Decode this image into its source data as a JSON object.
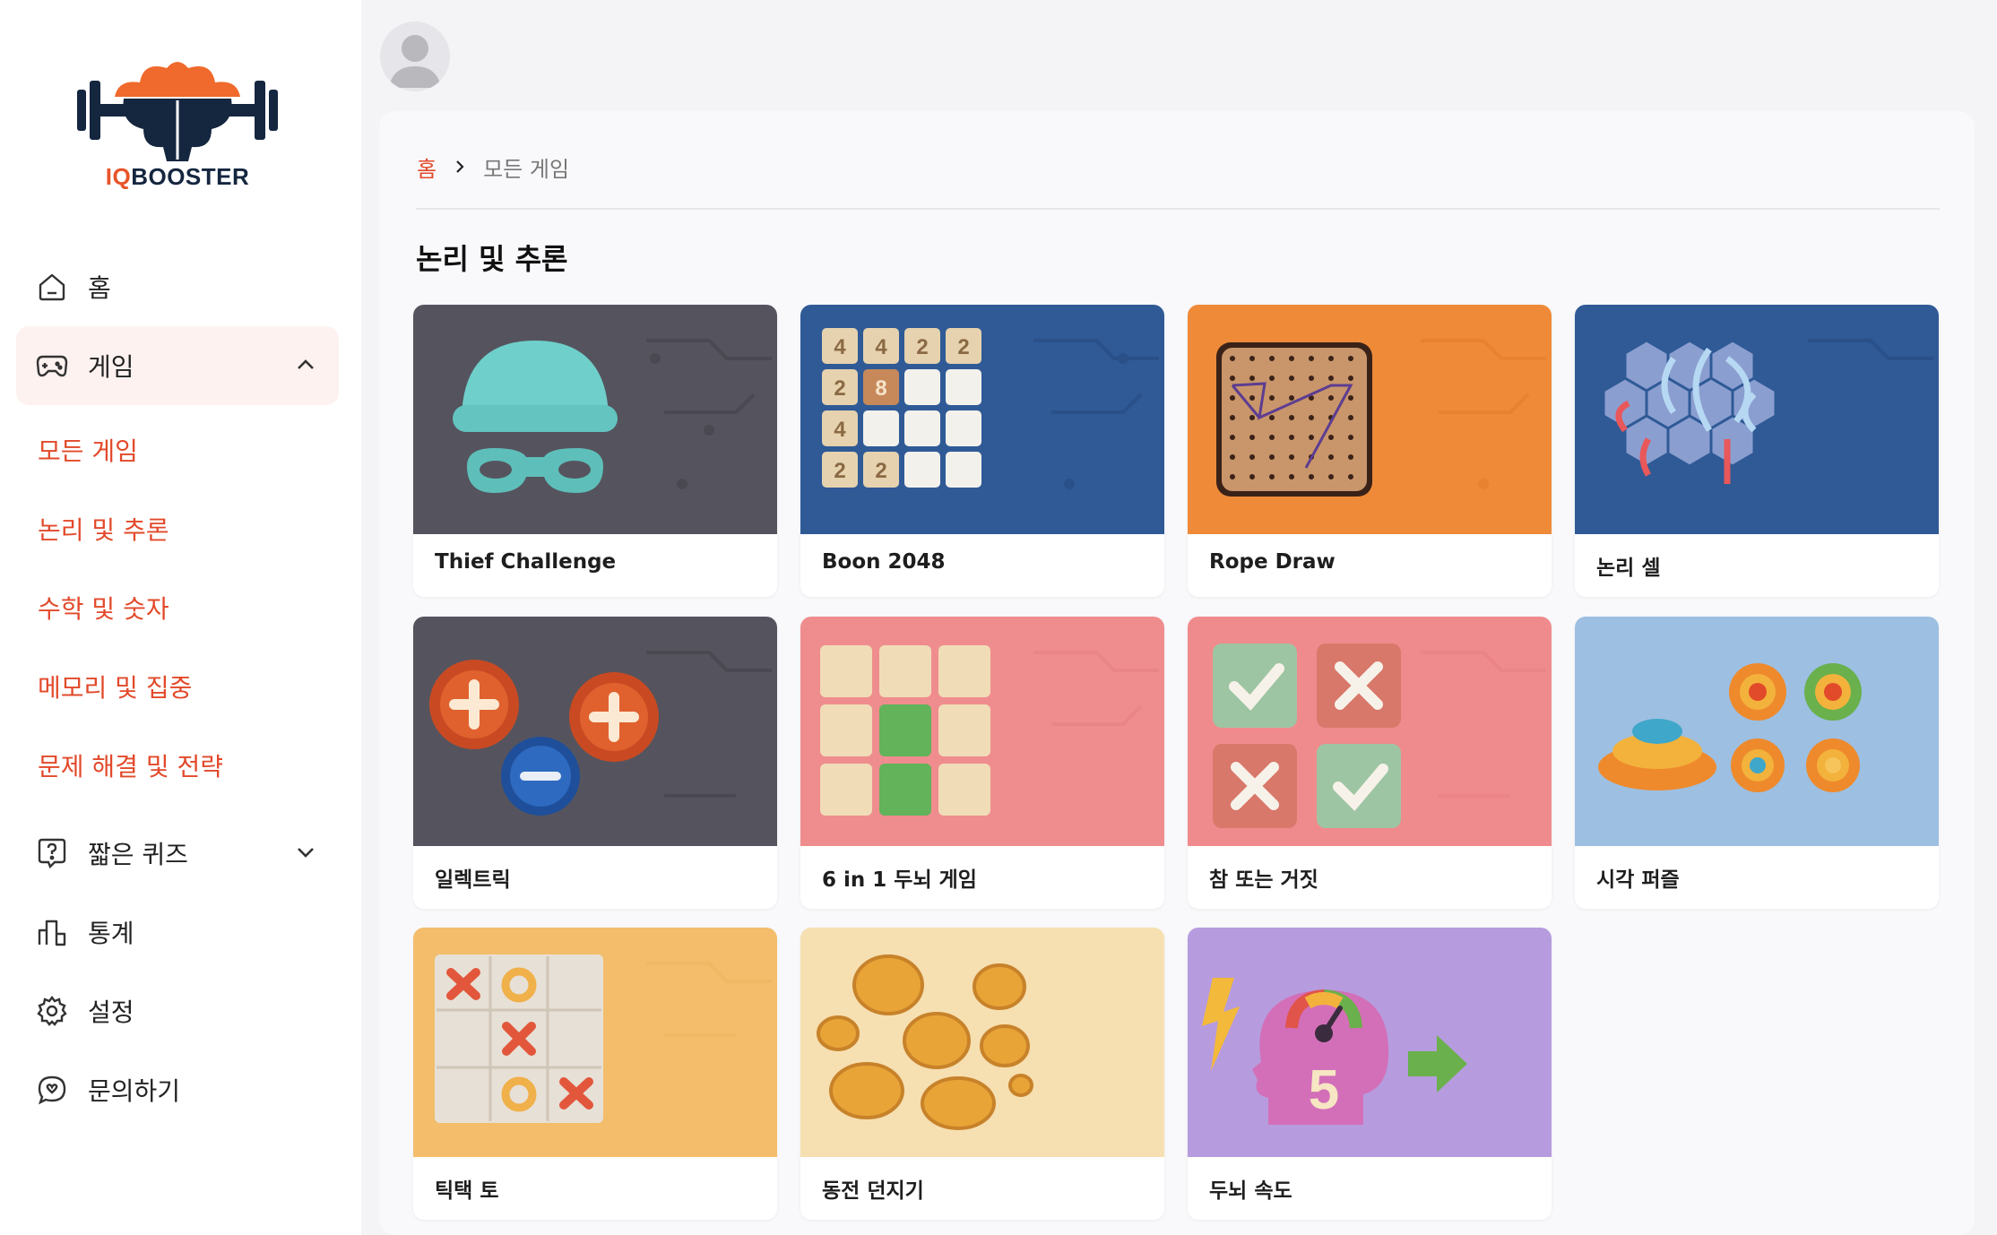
{
  "app": {
    "logo_text_iq": "IQ",
    "logo_text_rest": "BOOSTER"
  },
  "sidebar": {
    "home": "홈",
    "games": "게임",
    "game_sub": [
      "모든 게임",
      "논리 및 추론",
      "수학 및 숫자",
      "메모리 및 집중",
      "문제 해결 및 전략"
    ],
    "quiz": "짧은 퀴즈",
    "stats": "통계",
    "settings": "설정",
    "contact": "문의하기"
  },
  "breadcrumb": {
    "home": "홈",
    "current": "모든 게임"
  },
  "section": {
    "title": "논리 및 추론"
  },
  "games": [
    {
      "title": "Thief Challenge"
    },
    {
      "title": "Boon 2048",
      "tiles": [
        "4",
        "4",
        "2",
        "2",
        "2",
        "8",
        "",
        "",
        "4",
        "",
        "",
        "",
        "2",
        "2",
        "",
        ""
      ]
    },
    {
      "title": "Rope Draw"
    },
    {
      "title": "논리 셀"
    },
    {
      "title": "일렉트릭"
    },
    {
      "title": "6 in 1 두뇌 게임"
    },
    {
      "title": "참 또는 거짓"
    },
    {
      "title": "시각 퍼즐"
    },
    {
      "title": "틱택 토"
    },
    {
      "title": "동전 던지기"
    },
    {
      "title": "두뇌 속도",
      "number": "5"
    }
  ],
  "colors": {
    "accent": "#e2492a",
    "navy": "#15263f",
    "active_bg": "#fdf2ef"
  }
}
